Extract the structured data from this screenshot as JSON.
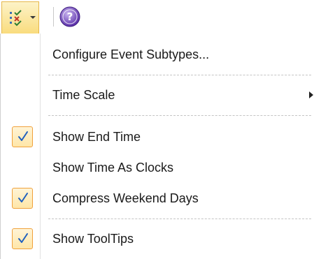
{
  "toolbar": {
    "options_icon": "checklist-icon",
    "dropdown_icon": "chevron-down-icon",
    "help_icon": "help-icon",
    "highlight_color": "#f9dc7e",
    "help_color": "#6a3fb8"
  },
  "menu": {
    "items": [
      {
        "label": "Configure Event Subtypes...",
        "checked": false,
        "submenu": false
      },
      {
        "label": "Time Scale",
        "checked": false,
        "submenu": true
      },
      {
        "label": "Show End Time",
        "checked": true,
        "submenu": false
      },
      {
        "label": "Show Time As Clocks",
        "checked": false,
        "submenu": false
      },
      {
        "label": "Compress Weekend Days",
        "checked": true,
        "submenu": false
      },
      {
        "label": "Show ToolTips",
        "checked": true,
        "submenu": false
      }
    ],
    "check_color": "#1f5fbf"
  }
}
